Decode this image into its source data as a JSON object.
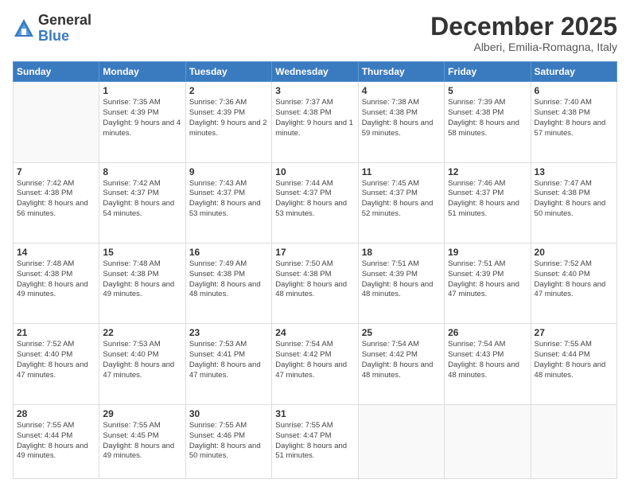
{
  "logo": {
    "general": "General",
    "blue": "Blue"
  },
  "header": {
    "month": "December 2025",
    "location": "Alberi, Emilia-Romagna, Italy"
  },
  "weekdays": [
    "Sunday",
    "Monday",
    "Tuesday",
    "Wednesday",
    "Thursday",
    "Friday",
    "Saturday"
  ],
  "weeks": [
    [
      {
        "day": "",
        "sunrise": "",
        "sunset": "",
        "daylight": ""
      },
      {
        "day": "1",
        "sunrise": "Sunrise: 7:35 AM",
        "sunset": "Sunset: 4:39 PM",
        "daylight": "Daylight: 9 hours and 4 minutes."
      },
      {
        "day": "2",
        "sunrise": "Sunrise: 7:36 AM",
        "sunset": "Sunset: 4:39 PM",
        "daylight": "Daylight: 9 hours and 2 minutes."
      },
      {
        "day": "3",
        "sunrise": "Sunrise: 7:37 AM",
        "sunset": "Sunset: 4:38 PM",
        "daylight": "Daylight: 9 hours and 1 minute."
      },
      {
        "day": "4",
        "sunrise": "Sunrise: 7:38 AM",
        "sunset": "Sunset: 4:38 PM",
        "daylight": "Daylight: 8 hours and 59 minutes."
      },
      {
        "day": "5",
        "sunrise": "Sunrise: 7:39 AM",
        "sunset": "Sunset: 4:38 PM",
        "daylight": "Daylight: 8 hours and 58 minutes."
      },
      {
        "day": "6",
        "sunrise": "Sunrise: 7:40 AM",
        "sunset": "Sunset: 4:38 PM",
        "daylight": "Daylight: 8 hours and 57 minutes."
      }
    ],
    [
      {
        "day": "7",
        "sunrise": "Sunrise: 7:42 AM",
        "sunset": "Sunset: 4:38 PM",
        "daylight": "Daylight: 8 hours and 56 minutes."
      },
      {
        "day": "8",
        "sunrise": "Sunrise: 7:42 AM",
        "sunset": "Sunset: 4:37 PM",
        "daylight": "Daylight: 8 hours and 54 minutes."
      },
      {
        "day": "9",
        "sunrise": "Sunrise: 7:43 AM",
        "sunset": "Sunset: 4:37 PM",
        "daylight": "Daylight: 8 hours and 53 minutes."
      },
      {
        "day": "10",
        "sunrise": "Sunrise: 7:44 AM",
        "sunset": "Sunset: 4:37 PM",
        "daylight": "Daylight: 8 hours and 53 minutes."
      },
      {
        "day": "11",
        "sunrise": "Sunrise: 7:45 AM",
        "sunset": "Sunset: 4:37 PM",
        "daylight": "Daylight: 8 hours and 52 minutes."
      },
      {
        "day": "12",
        "sunrise": "Sunrise: 7:46 AM",
        "sunset": "Sunset: 4:37 PM",
        "daylight": "Daylight: 8 hours and 51 minutes."
      },
      {
        "day": "13",
        "sunrise": "Sunrise: 7:47 AM",
        "sunset": "Sunset: 4:38 PM",
        "daylight": "Daylight: 8 hours and 50 minutes."
      }
    ],
    [
      {
        "day": "14",
        "sunrise": "Sunrise: 7:48 AM",
        "sunset": "Sunset: 4:38 PM",
        "daylight": "Daylight: 8 hours and 49 minutes."
      },
      {
        "day": "15",
        "sunrise": "Sunrise: 7:48 AM",
        "sunset": "Sunset: 4:38 PM",
        "daylight": "Daylight: 8 hours and 49 minutes."
      },
      {
        "day": "16",
        "sunrise": "Sunrise: 7:49 AM",
        "sunset": "Sunset: 4:38 PM",
        "daylight": "Daylight: 8 hours and 48 minutes."
      },
      {
        "day": "17",
        "sunrise": "Sunrise: 7:50 AM",
        "sunset": "Sunset: 4:38 PM",
        "daylight": "Daylight: 8 hours and 48 minutes."
      },
      {
        "day": "18",
        "sunrise": "Sunrise: 7:51 AM",
        "sunset": "Sunset: 4:39 PM",
        "daylight": "Daylight: 8 hours and 48 minutes."
      },
      {
        "day": "19",
        "sunrise": "Sunrise: 7:51 AM",
        "sunset": "Sunset: 4:39 PM",
        "daylight": "Daylight: 8 hours and 47 minutes."
      },
      {
        "day": "20",
        "sunrise": "Sunrise: 7:52 AM",
        "sunset": "Sunset: 4:40 PM",
        "daylight": "Daylight: 8 hours and 47 minutes."
      }
    ],
    [
      {
        "day": "21",
        "sunrise": "Sunrise: 7:52 AM",
        "sunset": "Sunset: 4:40 PM",
        "daylight": "Daylight: 8 hours and 47 minutes."
      },
      {
        "day": "22",
        "sunrise": "Sunrise: 7:53 AM",
        "sunset": "Sunset: 4:40 PM",
        "daylight": "Daylight: 8 hours and 47 minutes."
      },
      {
        "day": "23",
        "sunrise": "Sunrise: 7:53 AM",
        "sunset": "Sunset: 4:41 PM",
        "daylight": "Daylight: 8 hours and 47 minutes."
      },
      {
        "day": "24",
        "sunrise": "Sunrise: 7:54 AM",
        "sunset": "Sunset: 4:42 PM",
        "daylight": "Daylight: 8 hours and 47 minutes."
      },
      {
        "day": "25",
        "sunrise": "Sunrise: 7:54 AM",
        "sunset": "Sunset: 4:42 PM",
        "daylight": "Daylight: 8 hours and 48 minutes."
      },
      {
        "day": "26",
        "sunrise": "Sunrise: 7:54 AM",
        "sunset": "Sunset: 4:43 PM",
        "daylight": "Daylight: 8 hours and 48 minutes."
      },
      {
        "day": "27",
        "sunrise": "Sunrise: 7:55 AM",
        "sunset": "Sunset: 4:44 PM",
        "daylight": "Daylight: 8 hours and 48 minutes."
      }
    ],
    [
      {
        "day": "28",
        "sunrise": "Sunrise: 7:55 AM",
        "sunset": "Sunset: 4:44 PM",
        "daylight": "Daylight: 8 hours and 49 minutes."
      },
      {
        "day": "29",
        "sunrise": "Sunrise: 7:55 AM",
        "sunset": "Sunset: 4:45 PM",
        "daylight": "Daylight: 8 hours and 49 minutes."
      },
      {
        "day": "30",
        "sunrise": "Sunrise: 7:55 AM",
        "sunset": "Sunset: 4:46 PM",
        "daylight": "Daylight: 8 hours and 50 minutes."
      },
      {
        "day": "31",
        "sunrise": "Sunrise: 7:55 AM",
        "sunset": "Sunset: 4:47 PM",
        "daylight": "Daylight: 8 hours and 51 minutes."
      },
      {
        "day": "",
        "sunrise": "",
        "sunset": "",
        "daylight": ""
      },
      {
        "day": "",
        "sunrise": "",
        "sunset": "",
        "daylight": ""
      },
      {
        "day": "",
        "sunrise": "",
        "sunset": "",
        "daylight": ""
      }
    ]
  ]
}
